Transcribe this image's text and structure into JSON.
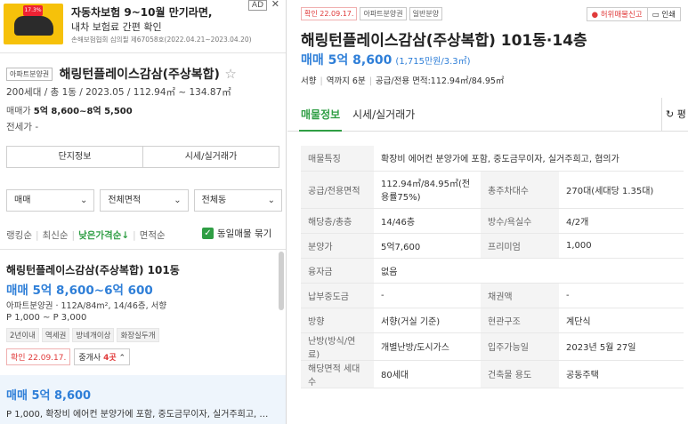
{
  "ad": {
    "thumb_badge": "17.3%",
    "title": "자동차보험 9~10월 만기라면,",
    "subtitle": "내차 보험료 간편 확인",
    "meta": "손해보험협회 심의필 제67058호(2022.04.21~2023.04.20)",
    "tag": "AD",
    "close": "✕"
  },
  "summary": {
    "type_tag": "아파트분양권",
    "title": "해링턴플레이스감삼(주상복합)",
    "star": "☆",
    "info": "200세대 / 총 1동 / 2023.05 / 112.94㎡ ~ 134.87㎡",
    "sale_label": "매매가",
    "sale_value": "5억 8,600~8억 5,500",
    "rent": "전세가 -"
  },
  "buttons": {
    "complex": "단지정보",
    "price": "시세/실거래가"
  },
  "filters": [
    {
      "label": "매매",
      "chev": "⌄"
    },
    {
      "label": "전체면적",
      "chev": "⌄"
    },
    {
      "label": "전체동",
      "chev": "⌄"
    }
  ],
  "sorts": {
    "ranking": "랭킹순",
    "latest": "최신순",
    "low_price": "낮은가격순↓",
    "area": "면적순",
    "checkbox_label": "동일매물 묶기",
    "check": "✓"
  },
  "card1": {
    "title": "해링턴플레이스감삼(주상복합) 101동",
    "price": "매매 5억 8,600~6억 600",
    "desc": "아파트분양권 · 112A/84m², 14/46층, 서향",
    "premium": "P 1,000 ~ P 3,000",
    "tags": [
      "2년이내",
      "역세권",
      "방네개이상",
      "화장실두개"
    ],
    "confirm": "확인 22.09.17.",
    "agent_prefix": "중개사",
    "agent_count": "4곳",
    "agent_chev": "⌃"
  },
  "card2": {
    "price": "매매 5억 8,600",
    "desc": "P 1,000, 확장비 에어컨 분양가에 포함, 중도금무이자, 실거주희고, …"
  },
  "right": {
    "tags": [
      "확인 22.09.17.",
      "아파트분양권",
      "일반분양"
    ],
    "report": "허위매물신고",
    "print": "인쇄",
    "title": "해링턴플레이스감삼(주상복합) 101동·14층",
    "price": "매매 5억 8,600",
    "unit_price": "(1,715만원/3.3㎡)",
    "direction": "서향",
    "station": "역까지 6분",
    "area": "공급/전용 면적:112.94㎡/84.95㎡",
    "tab_info": "매물정보",
    "tab_price": "시세/실거래가",
    "tab_side": "↻ 평",
    "rows": [
      {
        "h": "매물특징",
        "v": "확장비 에어컨 분양가에 포함, 중도금무이자, 실거주희고, 협의가",
        "span": true
      },
      {
        "h": "공급/전용면적",
        "v": "112.94㎡/84.95㎡(전용률75%)",
        "h2": "총주차대수",
        "v2": "270대(세대당 1.35대)",
        "tall": true
      },
      {
        "h": "해당층/총층",
        "v": "14/46층",
        "h2": "방수/욕실수",
        "v2": "4/2개"
      },
      {
        "h": "분양가",
        "v": "5억7,600",
        "h2": "프리미엄",
        "v2": "1,000"
      },
      {
        "h": "융자금",
        "v": "없음",
        "span": true
      },
      {
        "h": "납부중도금",
        "v": "-",
        "h2": "채권액",
        "v2": "-"
      },
      {
        "h": "방향",
        "v": "서향(거실 기준)",
        "h2": "현관구조",
        "v2": "계단식"
      },
      {
        "h": "난방(방식/연료)",
        "v": "개별난방/도시가스",
        "h2": "입주가능일",
        "v2": "2023년 5월 27일"
      },
      {
        "h": "해당면적 세대수",
        "v": "80세대",
        "h2": "건축물 용도",
        "v2": "공동주택"
      }
    ]
  }
}
